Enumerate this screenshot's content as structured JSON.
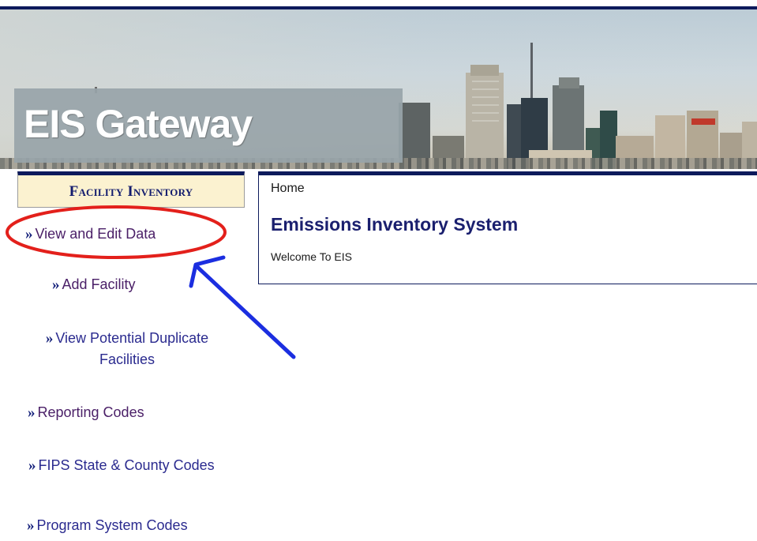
{
  "banner": {
    "title": "EIS Gateway"
  },
  "sidebar": {
    "header": "Facility Inventory",
    "items": [
      {
        "arrow": "»",
        "label": "View and Edit Data"
      },
      {
        "arrow": "»",
        "label": "Add Facility"
      },
      {
        "arrow": "»",
        "label": "View Potential Duplicate Facilities"
      },
      {
        "arrow": "»",
        "label": "Reporting Codes"
      },
      {
        "arrow": "»",
        "label": "FIPS State & County Codes"
      },
      {
        "arrow": "»",
        "label": "Program System Codes"
      }
    ]
  },
  "content": {
    "breadcrumb": "Home",
    "title": "Emissions Inventory System",
    "welcome": "Welcome To EIS"
  },
  "annotations": {
    "ellipse_color": "#e3201b",
    "arrow_color": "#1b2ee0"
  }
}
